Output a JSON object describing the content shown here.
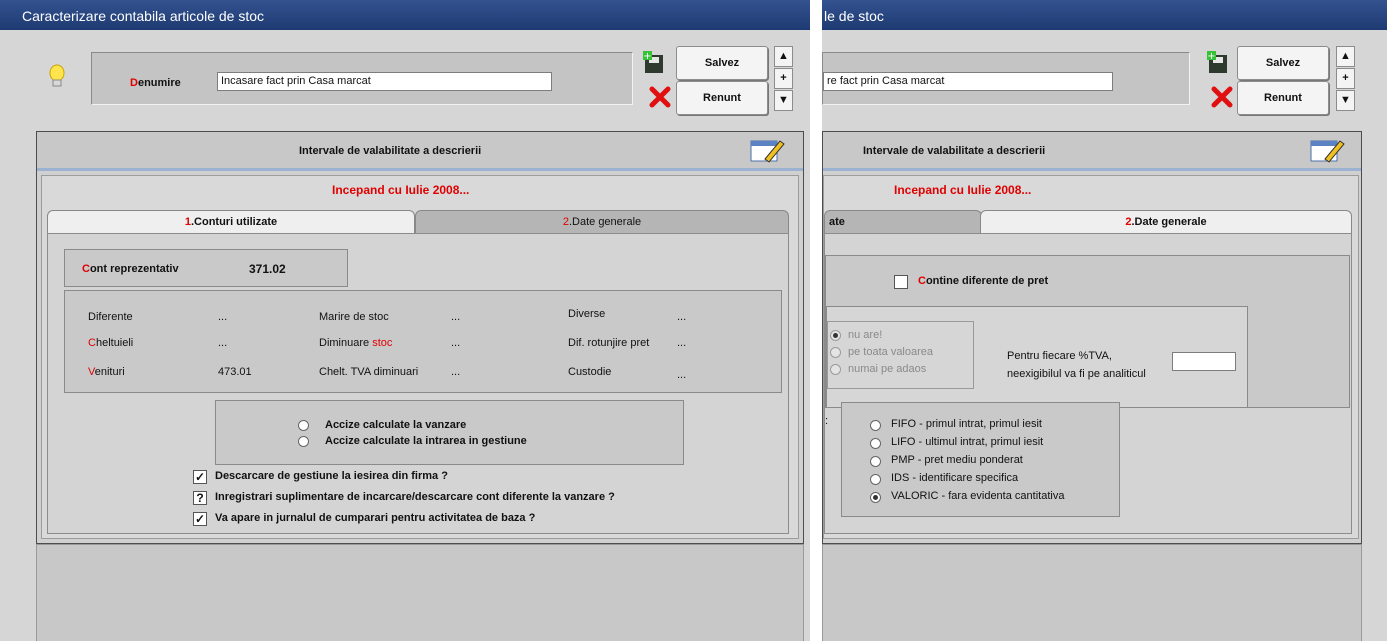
{
  "left": {
    "title": "Caracterizare contabila articole de stoc",
    "denumire_label": "Denumire",
    "denumire_value": "Incasare fact prin Casa marcat",
    "save_label": "Salvez",
    "cancel_label": "Renunt",
    "section_title": "Intervale de valabilitate a descrierii",
    "period": "Incepand cu Iulie 2008...",
    "tabs": [
      "1.Conturi utilizate",
      "2.Date generale"
    ],
    "cont_reprezentativ_label": "Cont reprezentativ",
    "cont_reprezentativ_value": "371.02",
    "accounts": {
      "diferente": {
        "label": "Diferente",
        "value": "..."
      },
      "cheltuieli": {
        "label": "Cheltuieli",
        "value": "..."
      },
      "venituri": {
        "label": "Venituri",
        "value": "473.01"
      },
      "marire_stoc": {
        "label": "Marire de stoc",
        "value": "..."
      },
      "diminuare_stoc": {
        "label": "Diminuare stoc",
        "value": "..."
      },
      "chelt_tva": {
        "label": "Chelt. TVA diminuari",
        "value": "..."
      },
      "diverse": {
        "label": "Diverse",
        "value": "..."
      },
      "dif_rotunjire": {
        "label": "Dif. rotunjire pret",
        "value": "..."
      },
      "custodie": {
        "label": "Custodie",
        "value": "..."
      }
    },
    "accize": [
      "Accize calculate la vanzare",
      "Accize calculate la intrarea in gestiune"
    ],
    "checks": [
      {
        "label": "Descarcare de gestiune la iesirea din firma ?",
        "mark": "✓"
      },
      {
        "label": "Inregistrari suplimentare de incarcare/descarcare cont diferente la vanzare ?",
        "mark": "?"
      },
      {
        "label": "Va apare in jurnalul de cumparari pentru activitatea de baza ?",
        "mark": "✓"
      }
    ]
  },
  "right": {
    "title": "le de stoc",
    "denumire_value": "re fact prin Casa marcat",
    "save_label": "Salvez",
    "cancel_label": "Renunt",
    "section_title": "Intervale de valabilitate a descrierii",
    "period": "Incepand cu Iulie 2008...",
    "tabs": [
      "ate",
      "2.Date generale"
    ],
    "contine_label": "Contine diferente de pret",
    "dif_options": [
      "nu are!",
      "pe toata valoarea",
      "numai pe adaos"
    ],
    "tva_text_1": "Pentru fiecare %TVA,",
    "tva_text_2": "neexigibilul va fi pe analiticul",
    "colon": ":",
    "methods": [
      "FIFO - primul intrat, primul iesit",
      "LIFO - ultimul intrat, primul iesit",
      "PMP - pret mediu ponderat",
      "IDS - identificare specifica",
      "VALORIC - fara evidenta cantitativa"
    ],
    "selected_method": 4
  },
  "icons": [
    "lightbulb-icon",
    "save-icon",
    "cancel-x-icon",
    "arrow-up-icon",
    "plus-icon",
    "arrow-down-icon",
    "calendar-edit-icon"
  ],
  "colors": {
    "title_bar": "#1e3a72",
    "hotkey_red": "#e00000",
    "panel": "#d0d0d0"
  }
}
